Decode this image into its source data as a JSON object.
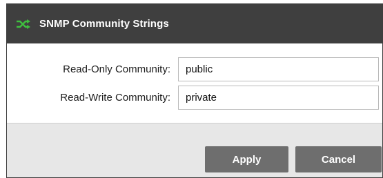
{
  "dialog": {
    "title": "SNMP Community Strings",
    "title_icon": "shuffle-icon",
    "accent_color": "#3fbf3f"
  },
  "fields": {
    "read_only": {
      "label": "Read-Only Community:",
      "value": "public"
    },
    "read_write": {
      "label": "Read-Write Community:",
      "value": "private"
    }
  },
  "buttons": {
    "apply_label": "Apply",
    "cancel_label": "Cancel"
  }
}
